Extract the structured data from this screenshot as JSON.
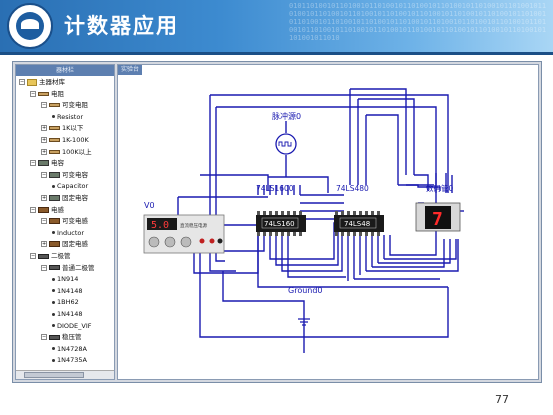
{
  "slide": {
    "title": "计数器应用",
    "page_number": "77"
  },
  "panel": {
    "title": "器材栏"
  },
  "tree": [
    {
      "label": "主器材库",
      "level": 0,
      "icon": "folder-icon",
      "expander": "−"
    },
    {
      "label": "电阻",
      "level": 1,
      "icon": "resistor-icon",
      "expander": "−"
    },
    {
      "label": "可变电阻",
      "level": 2,
      "icon": "resistor-icon",
      "expander": "−"
    },
    {
      "label": "Resistor",
      "level": 3,
      "icon": "leaf-icon"
    },
    {
      "label": "1K以下",
      "level": 2,
      "icon": "resistor-icon",
      "expander": "+"
    },
    {
      "label": "1K-100K",
      "level": 2,
      "icon": "resistor-icon",
      "expander": "+"
    },
    {
      "label": "100K以上",
      "level": 2,
      "icon": "resistor-icon",
      "expander": "+"
    },
    {
      "label": "电容",
      "level": 1,
      "icon": "capacitor-icon",
      "expander": "−"
    },
    {
      "label": "可变电容",
      "level": 2,
      "icon": "capacitor-icon",
      "expander": "−"
    },
    {
      "label": "Capacitor",
      "level": 3,
      "icon": "leaf-icon"
    },
    {
      "label": "固定电容",
      "level": 2,
      "icon": "capacitor-icon",
      "expander": "+"
    },
    {
      "label": "电感",
      "level": 1,
      "icon": "inductor-icon",
      "expander": "−"
    },
    {
      "label": "可变电感",
      "level": 2,
      "icon": "inductor-icon",
      "expander": "−"
    },
    {
      "label": "Inductor",
      "level": 3,
      "icon": "leaf-icon"
    },
    {
      "label": "固定电感",
      "level": 2,
      "icon": "inductor-icon",
      "expander": "+"
    },
    {
      "label": "二极管",
      "level": 1,
      "icon": "diode-icon",
      "expander": "−"
    },
    {
      "label": "普通二极管",
      "level": 2,
      "icon": "diode-icon",
      "expander": "−"
    },
    {
      "label": "1N914",
      "level": 3,
      "icon": "leaf-icon"
    },
    {
      "label": "1N4148",
      "level": 3,
      "icon": "leaf-icon"
    },
    {
      "label": "1BH62",
      "level": 3,
      "icon": "leaf-icon"
    },
    {
      "label": "1N4148",
      "level": 3,
      "icon": "leaf-icon"
    },
    {
      "label": "DIODE_VIF",
      "level": 3,
      "icon": "leaf-icon"
    },
    {
      "label": "稳压管",
      "level": 2,
      "icon": "diode-icon",
      "expander": "−"
    },
    {
      "label": "1N4728A",
      "level": 3,
      "icon": "leaf-icon"
    },
    {
      "label": "1N4735A",
      "level": 3,
      "icon": "leaf-icon"
    }
  ],
  "canvas": {
    "tab_label": "实验台",
    "components": {
      "pulse_source": "脉冲源0",
      "chip1_name": "74LS1600",
      "chip1_label": "74LS160",
      "chip2_name": "74LS480",
      "chip2_label": "74LS48",
      "display_name": "数码管0",
      "display_digit": "7",
      "supply_name": "V0",
      "supply_value": "5.0",
      "supply_text": "直流稳压电源",
      "ground_name": "Ground0"
    },
    "colors": {
      "wire": "#1a1ab0",
      "chip": "#1a1a1a",
      "segment": "#ff2a2a"
    }
  }
}
